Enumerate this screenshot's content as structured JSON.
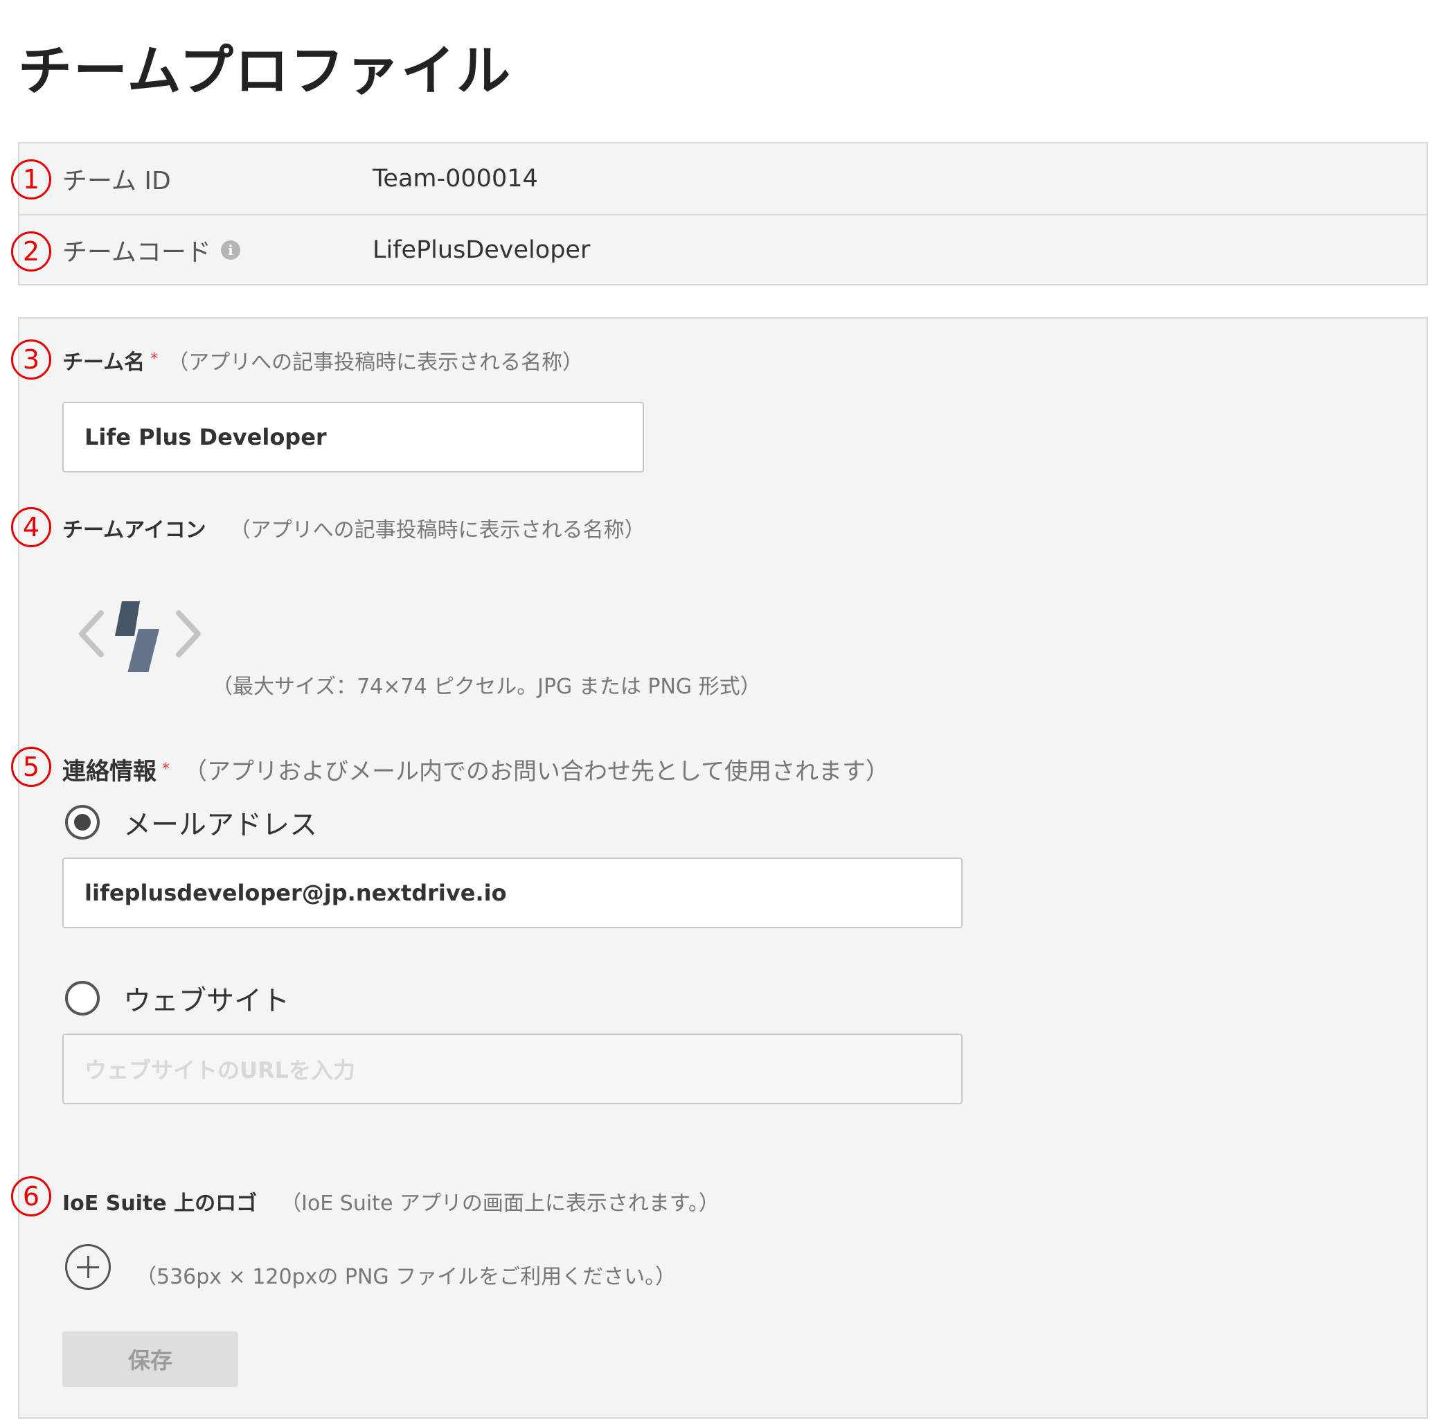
{
  "page": {
    "title": "チームプロファイル"
  },
  "markers": [
    "1",
    "2",
    "3",
    "4",
    "5",
    "6"
  ],
  "info": {
    "team_id_label": "チーム ID",
    "team_id_value": "Team-000014",
    "team_code_label": "チームコード",
    "team_code_value": "LifePlusDeveloper",
    "info_icon_glyph": "i"
  },
  "team_name": {
    "label": "チーム名",
    "required_mark": "*",
    "hint": "（アプリへの記事投稿時に表示される名称）",
    "value": "Life Plus Developer"
  },
  "team_icon": {
    "label": "チームアイコン",
    "hint": "（アプリへの記事投稿時に表示される名称）",
    "size_hint": "（最大サイズ：74×74 ピクセル。JPG または PNG 形式）",
    "icon_name": "code-bolt-icon"
  },
  "contact": {
    "label": "連絡情報",
    "required_mark": "*",
    "hint": "（アプリおよびメール内でのお問い合わせ先として使用されます）",
    "email_option": "メールアドレス",
    "email_value": "lifeplusdeveloper@jp.nextdrive.io",
    "website_option": "ウェブサイト",
    "website_placeholder": "ウェブサイトのURLを入力",
    "selected": "email"
  },
  "logo": {
    "label": "IoE Suite 上のロゴ",
    "hint": "（IoE Suite アプリの画面上に表示されます。）",
    "size_hint": "（536px × 120pxの PNG ファイルをご利用ください。）"
  },
  "actions": {
    "save_label": "保存"
  },
  "colors": {
    "marker": "#e60000",
    "required": "#e53935",
    "panel_bg": "#f4f4f4"
  }
}
